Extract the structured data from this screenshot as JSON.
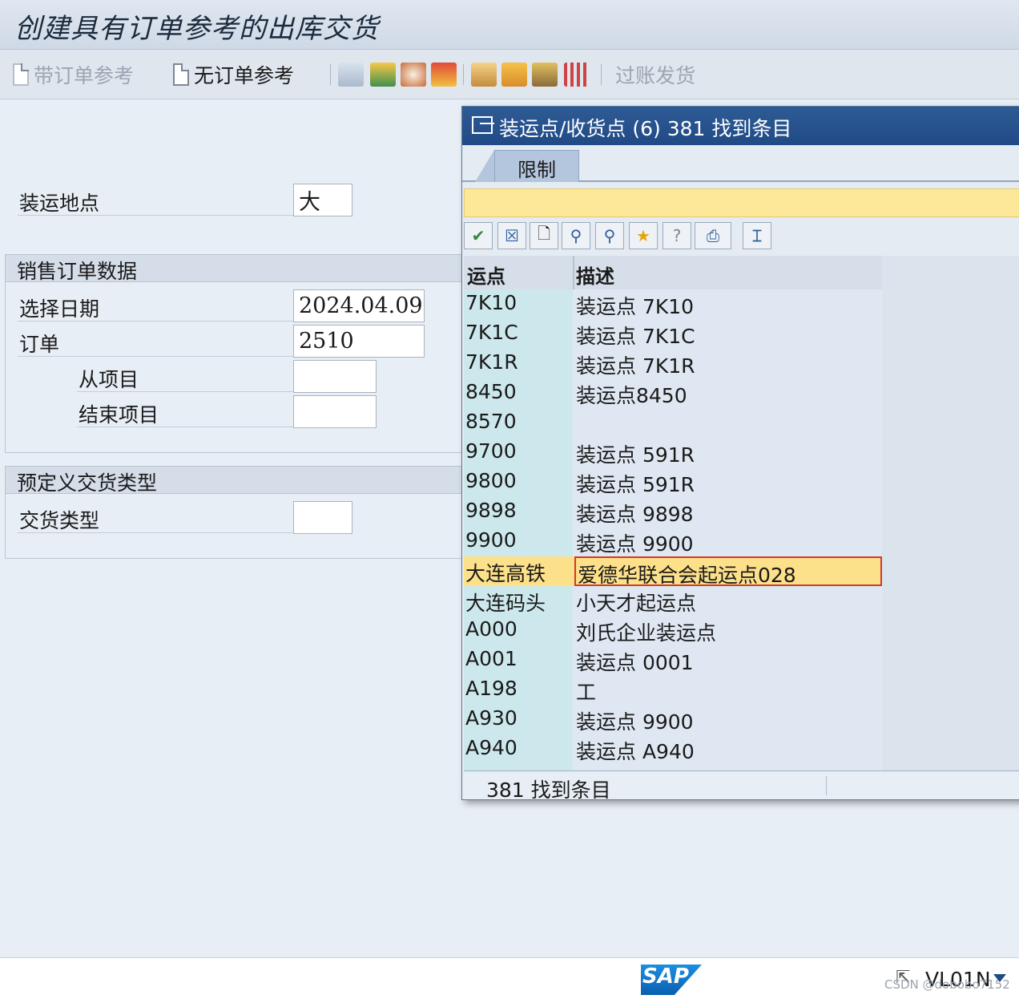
{
  "window": {
    "title": "创建具有订单参考的出库交货"
  },
  "toolbar": {
    "with_order_ref": "带订单参考",
    "without_order_ref": "无订单参考",
    "post_goods_issue": "过账发货"
  },
  "form": {
    "shipping_point_label": "装运地点",
    "shipping_point_value": "大",
    "sales_order_group_title": "销售订单数据",
    "selection_date_label": "选择日期",
    "selection_date_value": "2024.04.09",
    "order_label": "订单",
    "order_value": "2510",
    "from_item_label": "从项目",
    "from_item_value": "",
    "to_item_label": "结束项目",
    "to_item_value": "",
    "delivery_type_group_title": "预定义交货类型",
    "delivery_type_label": "交货类型",
    "delivery_type_value": ""
  },
  "dialog": {
    "title": "装运点/收货点 (6)  381 找到条目",
    "tab_label": "限制",
    "col_key": "运点",
    "col_desc": "描述",
    "rows": [
      {
        "key": "7K10",
        "desc": "装运点 7K10"
      },
      {
        "key": "7K1C",
        "desc": "装运点 7K1C"
      },
      {
        "key": "7K1R",
        "desc": "装运点 7K1R"
      },
      {
        "key": "8450",
        "desc": "装运点8450"
      },
      {
        "key": "8570",
        "desc": ""
      },
      {
        "key": "9700",
        "desc": "装运点 591R"
      },
      {
        "key": "9800",
        "desc": "装运点 591R"
      },
      {
        "key": "9898",
        "desc": "装运点 9898"
      },
      {
        "key": "9900",
        "desc": "装运点 9900"
      },
      {
        "key": "大连高铁",
        "desc": "爱德华联合会起运点028"
      },
      {
        "key": "大连码头",
        "desc": "小天才起运点"
      },
      {
        "key": "A000",
        "desc": "刘氏企业装运点"
      },
      {
        "key": "A001",
        "desc": "装运点 0001"
      },
      {
        "key": "A198",
        "desc": "工"
      },
      {
        "key": "A930",
        "desc": "装运点 9900"
      },
      {
        "key": "A940",
        "desc": "装运点 A940"
      }
    ],
    "status_text": "381 找到条目"
  },
  "footer": {
    "transaction_code": "VL01N",
    "watermark": "CSDN @dobobo7152"
  },
  "colors": {
    "title_bar": "#1f4a86",
    "selected_row": "#fde08a",
    "key_column": "#cce8ec",
    "yellow_bar": "#fde89a"
  }
}
